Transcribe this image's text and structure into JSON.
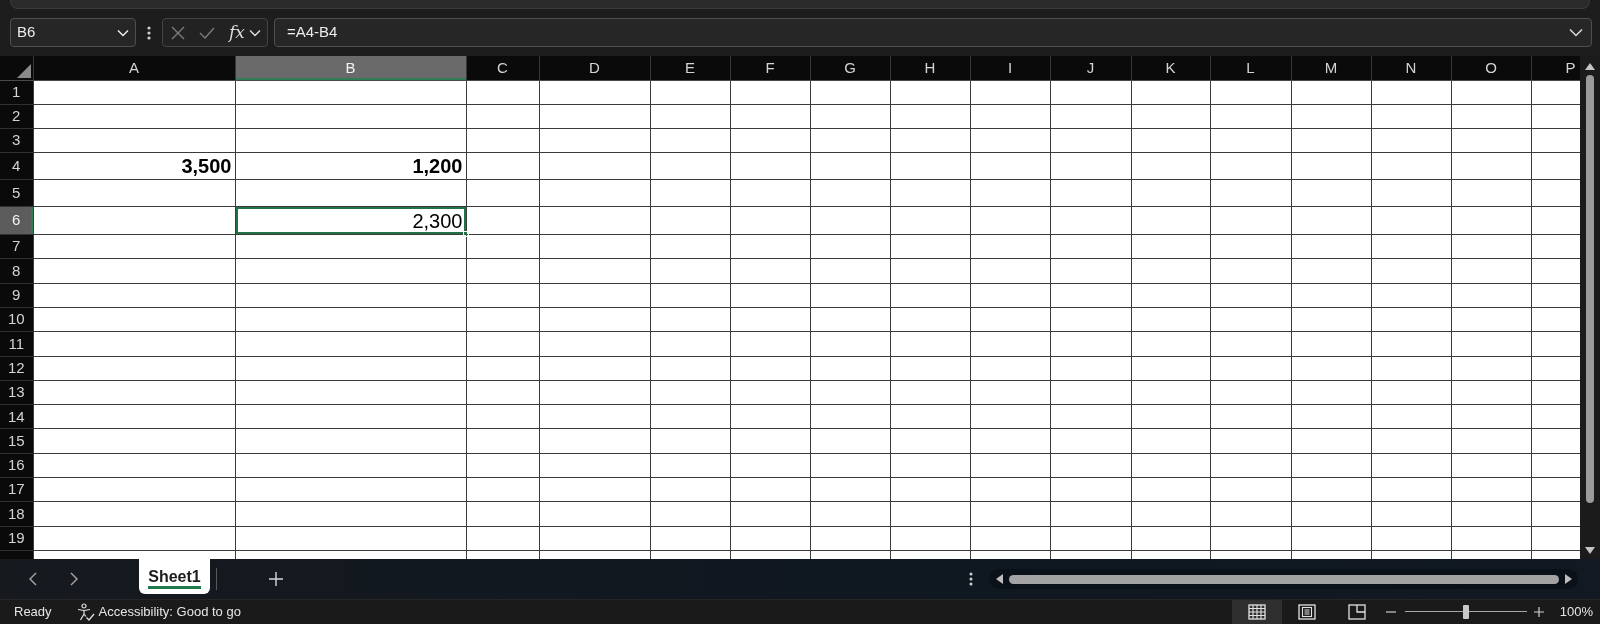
{
  "formula_bar": {
    "name_box": "B6",
    "buttons": [
      {
        "kind": "cancel",
        "disabled": true
      },
      {
        "kind": "enter",
        "disabled": true
      },
      {
        "kind": "function",
        "label": "fx",
        "disabled": false
      }
    ],
    "formula": "=A4-B4"
  },
  "grid": {
    "columns": [
      {
        "label": "A",
        "selected": false
      },
      {
        "label": "B",
        "selected": true
      },
      {
        "label": "C",
        "selected": false
      },
      {
        "label": "D",
        "selected": false
      },
      {
        "label": "E",
        "selected": false
      },
      {
        "label": "F",
        "selected": false
      },
      {
        "label": "G",
        "selected": false
      },
      {
        "label": "H",
        "selected": false
      },
      {
        "label": "I",
        "selected": false
      },
      {
        "label": "J",
        "selected": false
      },
      {
        "label": "K",
        "selected": false
      },
      {
        "label": "L",
        "selected": false
      },
      {
        "label": "M",
        "selected": false
      },
      {
        "label": "N",
        "selected": false
      },
      {
        "label": "O",
        "selected": false
      },
      {
        "label": "P",
        "selected": false
      }
    ],
    "rows": [
      {
        "label": "1",
        "selected": false
      },
      {
        "label": "2",
        "selected": false
      },
      {
        "label": "3",
        "selected": false
      },
      {
        "label": "4",
        "selected": false,
        "cells": [
          {
            "value": "3,500",
            "bold": true,
            "selected": false
          },
          {
            "value": "1,200",
            "bold": true,
            "selected": false
          }
        ]
      },
      {
        "label": "5",
        "selected": false
      },
      {
        "label": "6",
        "selected": true,
        "cells": [
          {
            "selected": false
          },
          {
            "value": "2,300",
            "bold": false,
            "selected": true
          }
        ]
      },
      {
        "label": "7",
        "selected": false
      },
      {
        "label": "8",
        "selected": false
      },
      {
        "label": "9",
        "selected": false
      },
      {
        "label": "10",
        "selected": false
      },
      {
        "label": "11",
        "selected": false
      },
      {
        "label": "12",
        "selected": false
      },
      {
        "label": "13",
        "selected": false
      },
      {
        "label": "14",
        "selected": false
      },
      {
        "label": "15",
        "selected": false
      },
      {
        "label": "16",
        "selected": false
      },
      {
        "label": "17",
        "selected": false
      },
      {
        "label": "18",
        "selected": false
      },
      {
        "label": "19",
        "selected": false
      }
    ]
  },
  "sheet_tabs": [
    {
      "label": "Sheet1",
      "selected": true
    }
  ],
  "status_bar": {
    "status": "Ready",
    "accessibility": "Accessibility: Good to go",
    "views": [
      {
        "kind": "normal",
        "selected": true
      },
      {
        "kind": "page_layout",
        "selected": false
      },
      {
        "kind": "page_break",
        "selected": false
      }
    ],
    "zoom": {
      "level": 0.5,
      "reading": "100%"
    }
  }
}
